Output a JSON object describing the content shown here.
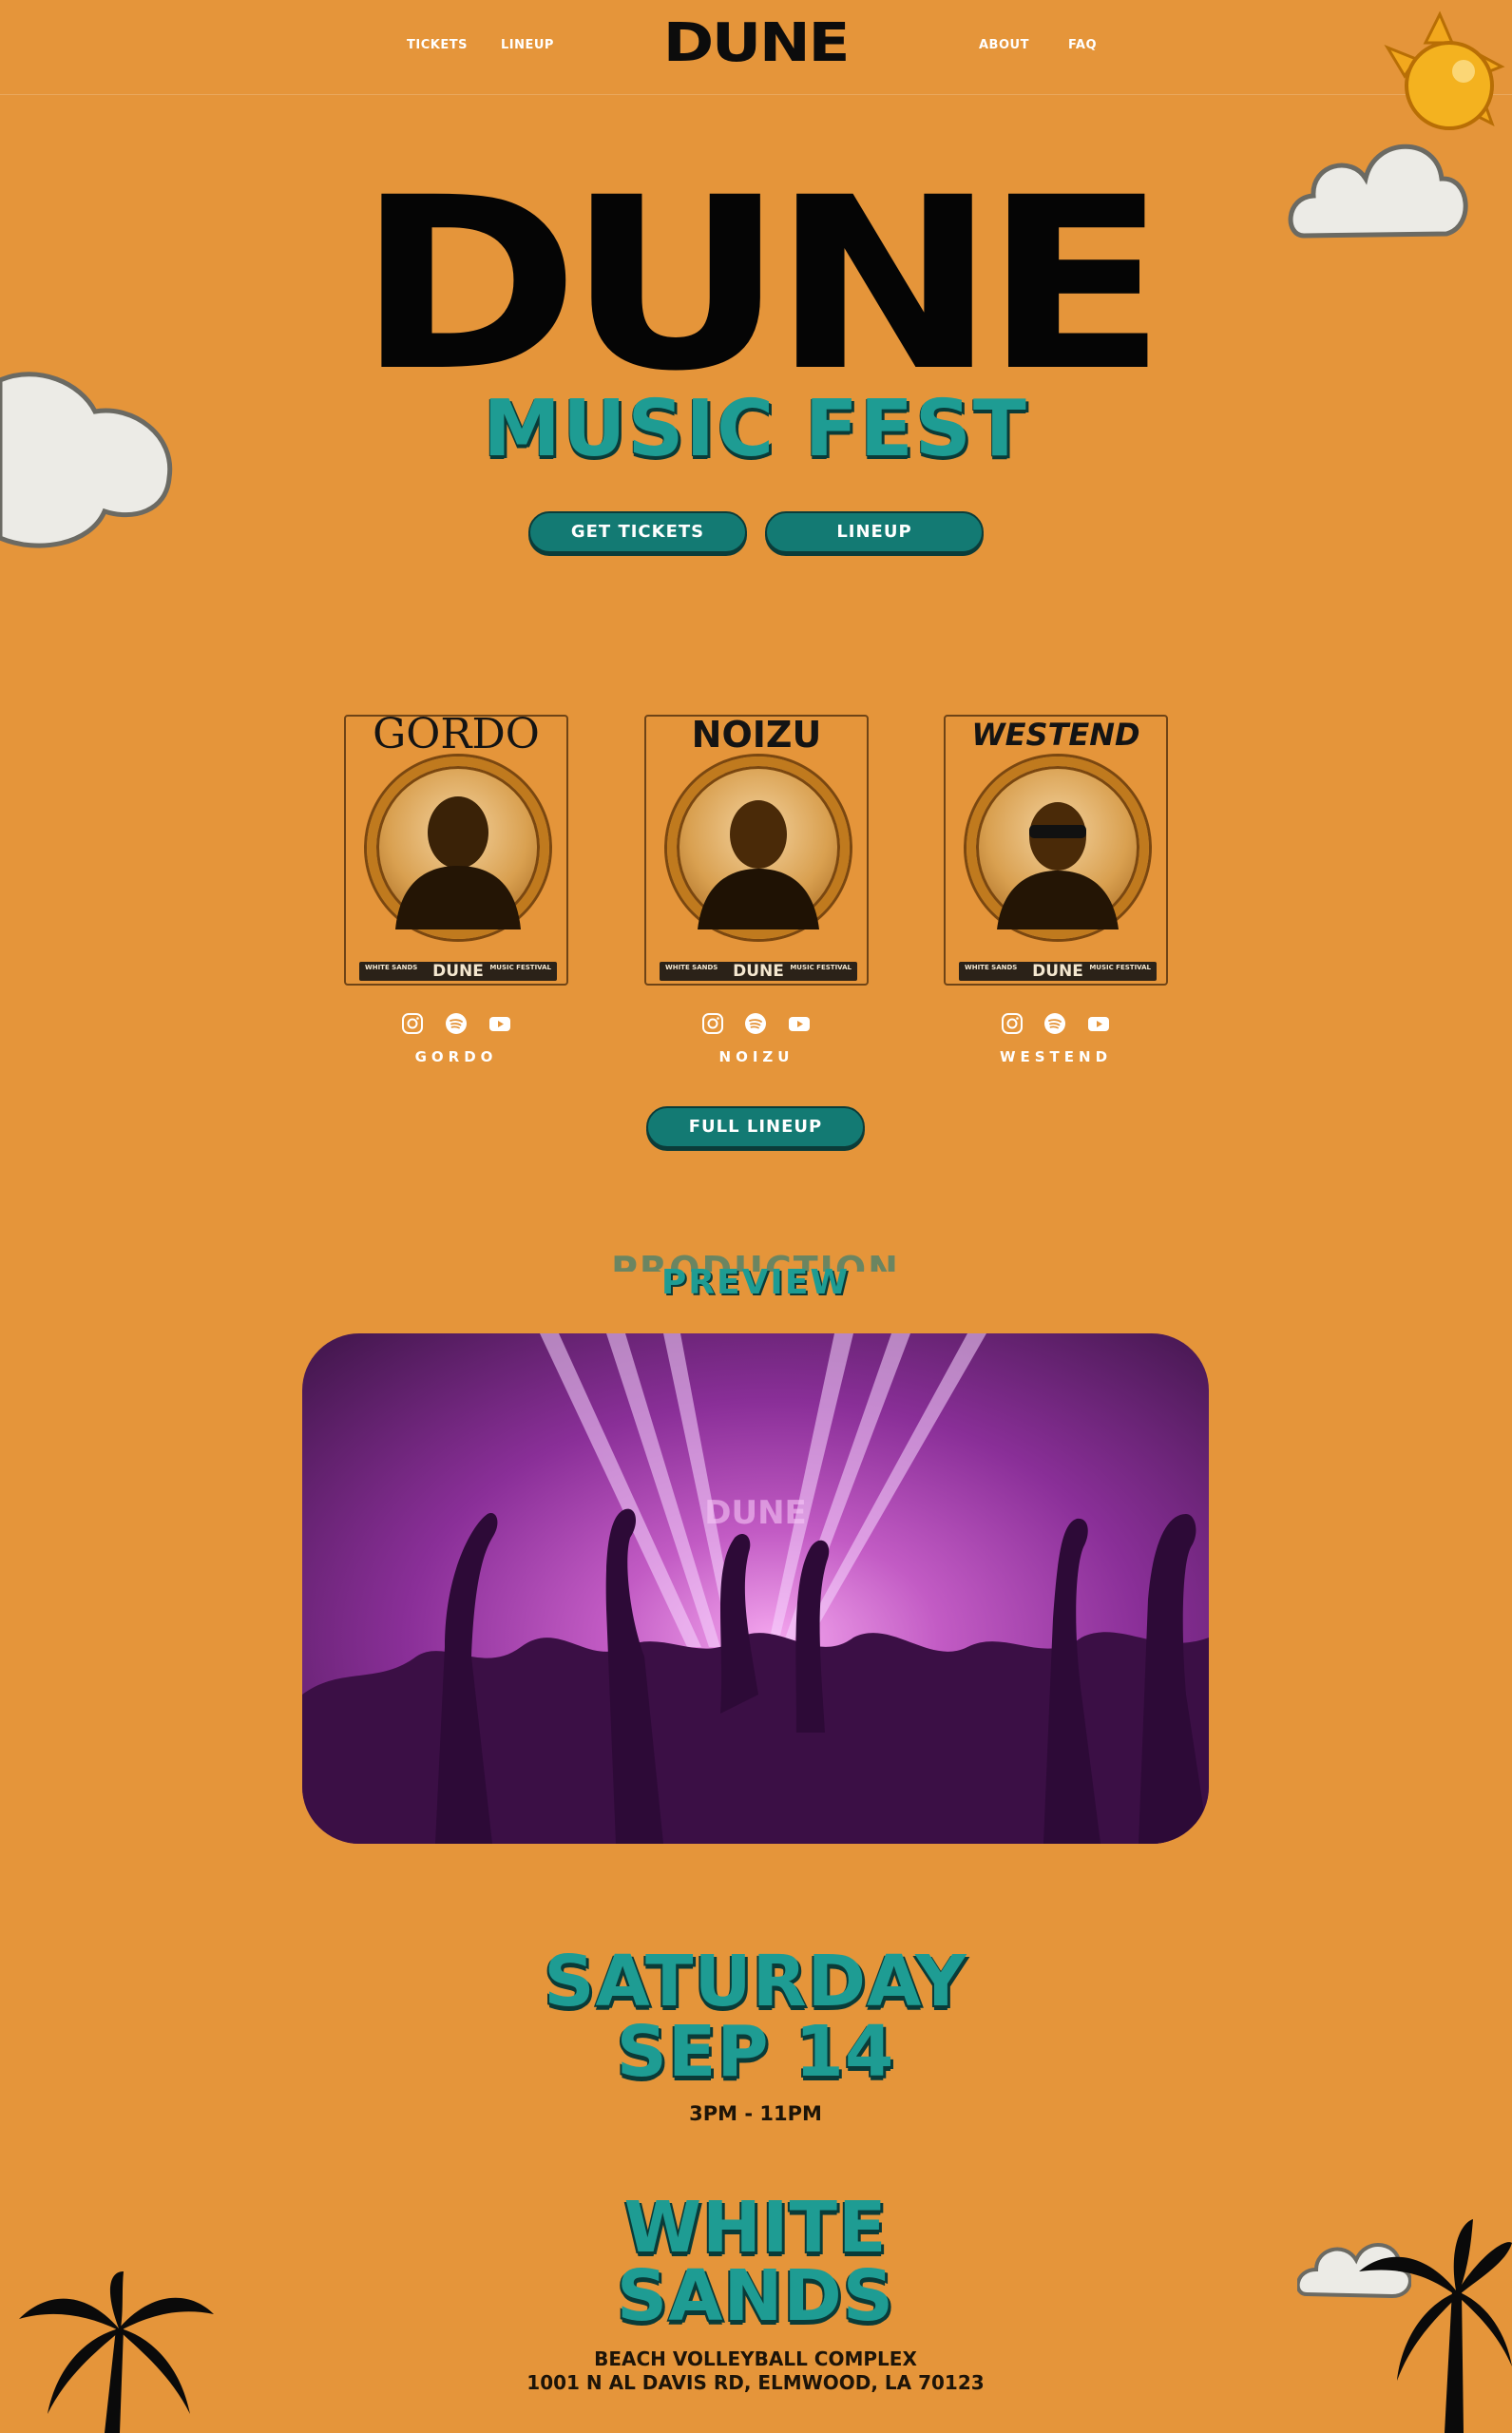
{
  "nav": {
    "tickets": "TICKETS",
    "lineup": "LINEUP",
    "logo": "DUNE",
    "about": "ABOUT",
    "faq": "FAQ"
  },
  "hero": {
    "title": "DUNE",
    "subtitle": "MUSIC FEST",
    "get_tickets_label": "GET TICKETS",
    "lineup_label": "LINEUP"
  },
  "artists": [
    {
      "name": "GORDO",
      "poster_name": "GORDO",
      "footer_brand": "DUNE",
      "footer_left": "WHITE SANDS",
      "footer_right": "MUSIC FESTIVAL"
    },
    {
      "name": "NOIZU",
      "poster_name": "NOIZU",
      "footer_brand": "DUNE",
      "footer_left": "WHITE SANDS",
      "footer_right": "MUSIC FESTIVAL"
    },
    {
      "name": "WESTEND",
      "poster_name": "WESTEND",
      "footer_brand": "DUNE",
      "footer_left": "WHITE SANDS",
      "footer_right": "MUSIC FESTIVAL"
    }
  ],
  "full_lineup_label": "FULL LINEUP",
  "production": {
    "ghost": "PRODUCTION",
    "title": "PREVIEW",
    "screen_brand": "DUNE"
  },
  "event": {
    "day": "SATURDAY",
    "date": "SEP 14",
    "time": "3PM - 11PM"
  },
  "venue": {
    "line1": "WHITE",
    "line2": "SANDS",
    "name": "BEACH VOLLEYBALL COMPLEX",
    "address": "1001 N AL DAVIS RD, ELMWOOD, LA 70123"
  },
  "colors": {
    "background": "#E5953A",
    "teal": "#1E9C93",
    "button": "#137A73"
  },
  "icons": [
    "instagram-icon",
    "spotify-icon",
    "youtube-icon",
    "sun-icon",
    "cloud-icon",
    "palm-tree-icon"
  ]
}
